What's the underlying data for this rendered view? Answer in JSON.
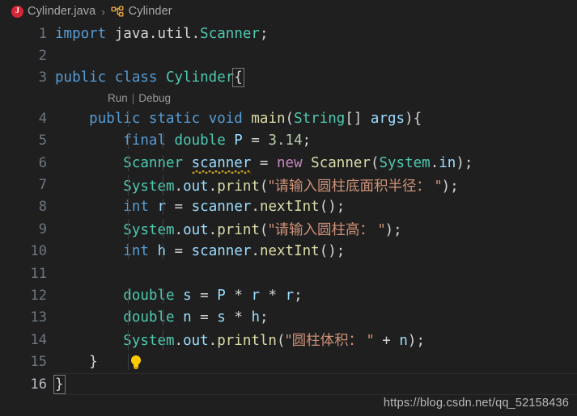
{
  "breadcrumb": {
    "file_icon": "java-file-icon",
    "file_label": "Cylinder.java",
    "separator": "›",
    "class_icon": "class-symbol-icon",
    "class_label": "Cylinder"
  },
  "codelens": {
    "run_label": "Run",
    "separator": "|",
    "debug_label": "Debug"
  },
  "gutter": {
    "numbers": [
      "1",
      "2",
      "3",
      "4",
      "5",
      "6",
      "7",
      "8",
      "9",
      "10",
      "11",
      "12",
      "13",
      "14",
      "15",
      "16"
    ]
  },
  "lightbulb": {
    "name": "quick-fix-lightbulb",
    "line": "15"
  },
  "colors": {
    "background": "#1f1f1f",
    "keyword": "#569cd6",
    "control": "#c586c0",
    "type": "#4ec9b0",
    "variable": "#9cdcfe",
    "function": "#dcdcaa",
    "string": "#ce9178",
    "number": "#b5cea8",
    "punctuation": "#d4d4d4",
    "line_number": "#6e7681",
    "indent_guide": "#3d4044",
    "squiggle_warning": "#c8a020",
    "lightbulb": "#ffcc00"
  },
  "code_lines": {
    "l1": "import java.util.Scanner;",
    "l2": "",
    "l3": "public class Cylinder{",
    "l4": "    public static void main(String[] args){",
    "l5": "        final double P = 3.14;",
    "l6": "        Scanner scanner = new Scanner(System.in);",
    "l7": "        System.out.print(\"请输入圆柱底面积半径： \");",
    "l8": "        int r = scanner.nextInt();",
    "l9": "        System.out.print(\"请输入圆柱高： \");",
    "l10": "        int h = scanner.nextInt();",
    "l11": "",
    "l12": "        double s = P * r * r;",
    "l13": "        double n = s * h;",
    "l14": "        System.out.println(\"圆柱体积： \" + n);",
    "l15": "    }",
    "l16": "}"
  },
  "tokens": {
    "kw_import": "import",
    "pkg_java": " java",
    "dot": ".",
    "pkg_util": "util",
    "type_scanner": "Scanner",
    "semi": ";",
    "kw_public": "public",
    "kw_class": "class",
    "type_cylinder": "Cylinder",
    "brace_open": "{",
    "brace_close": "}",
    "kw_static": "static",
    "kw_void": "void",
    "fn_main": "main",
    "paren_open": "(",
    "type_string": "String",
    "brackets": "[]",
    "var_args": " args",
    "paren_close": ")",
    "kw_final": "final",
    "type_double": "double",
    "var_P": "P",
    "eq": "=",
    "num_pi": "3.14",
    "var_scanner": "scanner",
    "kw_new": "new",
    "type_system": "System",
    "var_in": "in",
    "var_out": "out",
    "fn_print": "print",
    "fn_println": "println",
    "str_radius": "\"请输入圆柱底面积半径： \"",
    "str_height": "\"请输入圆柱高： \"",
    "str_volume": "\"圆柱体积： \"",
    "kw_int": "int",
    "var_r": "r",
    "var_h": "h",
    "var_s": "s",
    "var_n": "n",
    "fn_nextInt": "nextInt",
    "parens_empty": "()",
    "star": "*",
    "plus": "+",
    "type_double2": "double"
  },
  "watermark": {
    "text": "https://blog.csdn.net/qq_52158436"
  }
}
